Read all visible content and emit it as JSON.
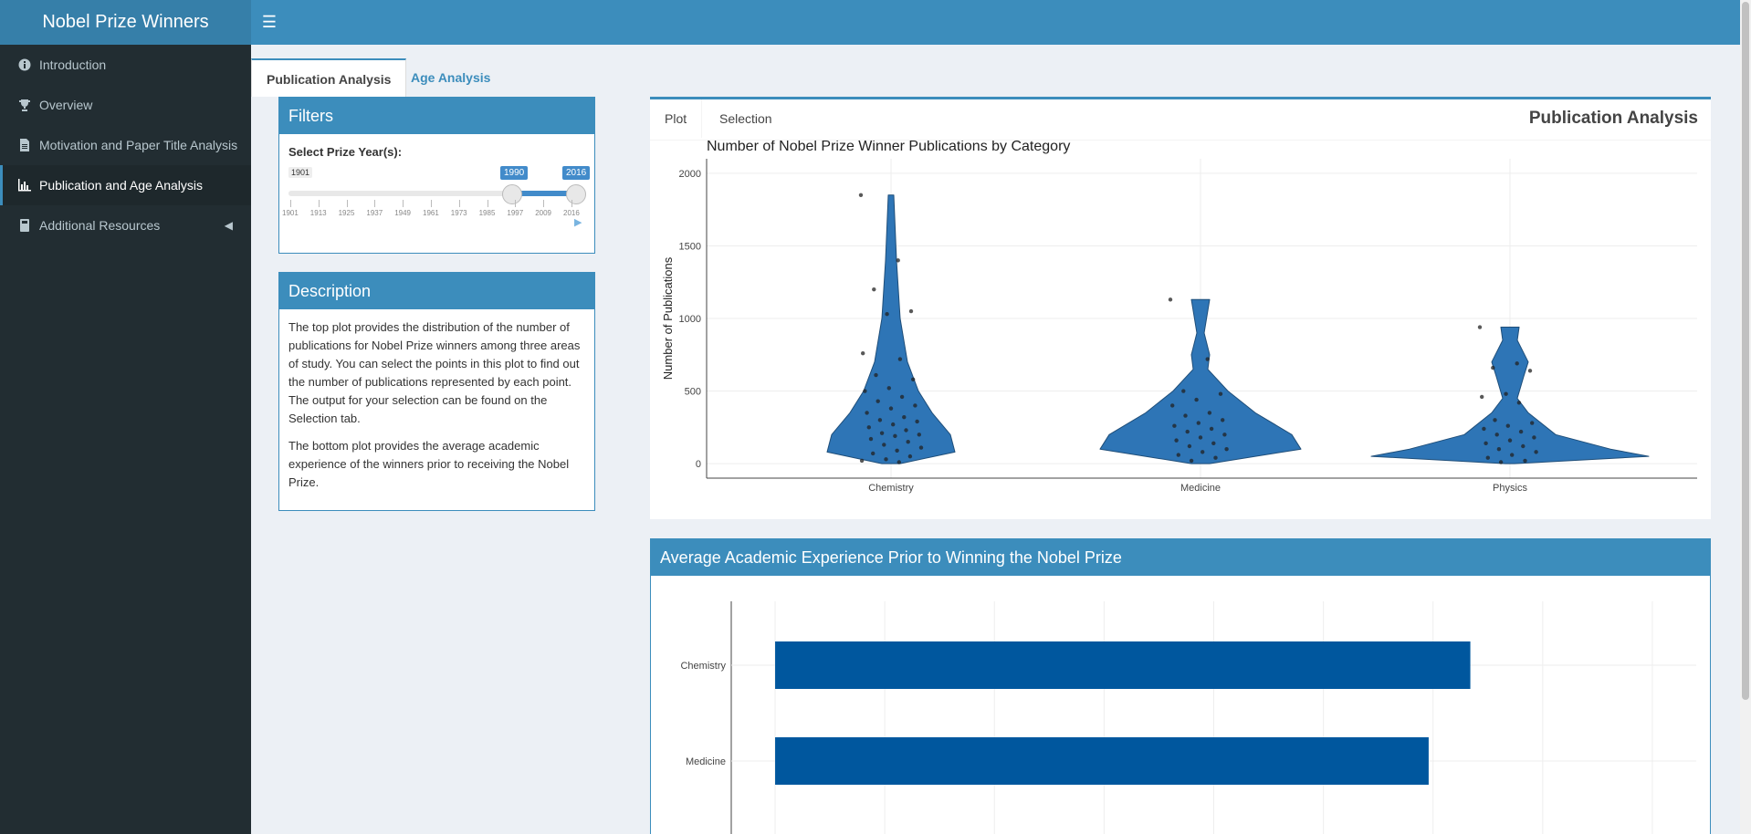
{
  "app": {
    "title": "Nobel Prize Winners"
  },
  "sidebar": {
    "items": [
      {
        "label": "Introduction",
        "icon": "info-circle-icon"
      },
      {
        "label": "Overview",
        "icon": "trophy-icon"
      },
      {
        "label": "Motivation and Paper Title Analysis",
        "icon": "file-text-icon"
      },
      {
        "label": "Publication and Age Analysis",
        "icon": "bar-chart-icon"
      },
      {
        "label": "Additional Resources",
        "icon": "book-icon"
      }
    ]
  },
  "tabs": [
    "Publication Analysis",
    "Age Analysis"
  ],
  "filters": {
    "title": "Filters",
    "label": "Select Prize Year(s):",
    "min": "1901",
    "from": "1990",
    "to": "2016",
    "ticks": [
      "1901",
      "1913",
      "1925",
      "1937",
      "1949",
      "1961",
      "1973",
      "1985",
      "1997",
      "2009",
      "2016"
    ]
  },
  "description": {
    "title": "Description",
    "p1": "The top plot provides the distribution of the number of publications for Nobel Prize winners among three areas of study. You can select the points in this plot to find out the number of publications represented by each point. The output for your selection can be found on the Selection tab.",
    "p2": "The bottom plot provides the average academic experience of the winners prior to receiving the Nobel Prize."
  },
  "plot_panel": {
    "tabs": [
      "Plot",
      "Selection"
    ],
    "title": "Publication Analysis"
  },
  "bar_panel": {
    "title": "Average Academic Experience Prior to Winning the Nobel Prize"
  },
  "colors": {
    "primary": "#3c8dbc",
    "violin": "#2e75b6",
    "bar": "#00579e",
    "sidebar": "#222d32"
  },
  "chart_data": [
    {
      "type": "violin",
      "title": "Number of Nobel Prize Winner Publications by Category",
      "xlabel": "",
      "ylabel": "Number of Publications",
      "categories": [
        "Chemistry",
        "Medicine",
        "Physics"
      ],
      "yticks": [
        0,
        500,
        1000,
        1500,
        2000
      ],
      "ylim": [
        -100,
        2100
      ],
      "max_values": [
        1850,
        1130,
        940
      ],
      "points": {
        "Chemistry": [
          1850,
          1400,
          1200,
          1050,
          1030,
          760,
          720,
          610,
          580,
          520,
          500,
          460,
          430,
          400,
          380,
          350,
          320,
          300,
          290,
          270,
          250,
          230,
          210,
          200,
          190,
          170,
          150,
          130,
          110,
          90,
          70,
          50,
          30,
          20,
          10
        ],
        "Medicine": [
          1130,
          720,
          500,
          480,
          440,
          400,
          350,
          330,
          300,
          280,
          260,
          240,
          220,
          200,
          180,
          160,
          140,
          120,
          100,
          80,
          60,
          40,
          20
        ],
        "Physics": [
          940,
          690,
          660,
          640,
          480,
          460,
          420,
          300,
          280,
          260,
          240,
          220,
          200,
          180,
          160,
          140,
          120,
          100,
          80,
          60,
          40,
          20,
          10
        ]
      }
    },
    {
      "type": "bar",
      "title": "Average Academic Experience Prior to Winning the Nobel Prize",
      "orientation": "horizontal",
      "categories": [
        "Chemistry",
        "Medicine"
      ],
      "values": [
        31.7,
        29.8
      ],
      "xlim": [
        -2,
        42
      ]
    }
  ]
}
